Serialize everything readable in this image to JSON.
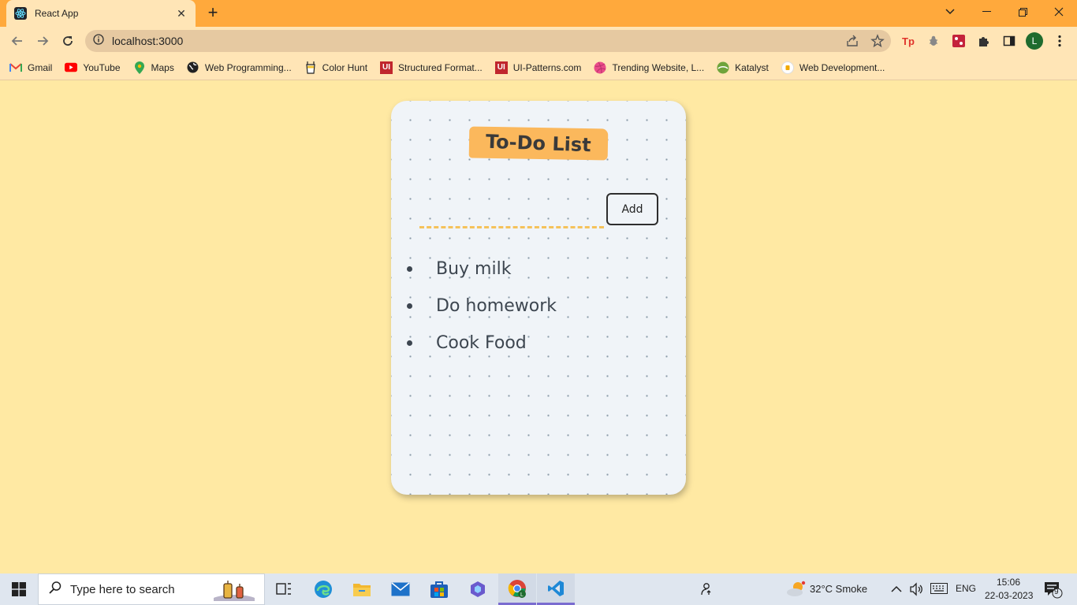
{
  "browser": {
    "tab_title": "React App",
    "url": "localhost:3000",
    "profile_initial": "L",
    "bookmarks": [
      {
        "label": "Gmail",
        "icon": "gmail-icon"
      },
      {
        "label": "YouTube",
        "icon": "youtube-icon"
      },
      {
        "label": "Maps",
        "icon": "maps-icon"
      },
      {
        "label": "Web Programming...",
        "icon": "globe-icon"
      },
      {
        "label": "Color Hunt",
        "icon": "color-hunt-icon"
      },
      {
        "label": "Structured Format...",
        "icon": "ui-icon"
      },
      {
        "label": "UI-Patterns.com",
        "icon": "ui-icon"
      },
      {
        "label": "Trending Website, L...",
        "icon": "dribbble-icon"
      },
      {
        "label": "Katalyst",
        "icon": "katalyst-icon"
      },
      {
        "label": "Web Development...",
        "icon": "web-dev-icon"
      }
    ]
  },
  "app": {
    "title": "To-Do List",
    "add_label": "Add",
    "input_value": "",
    "items": [
      "Buy milk",
      "Do homework",
      "Cook Food"
    ]
  },
  "taskbar": {
    "search_placeholder": "Type here to search",
    "weather": "32°C  Smoke",
    "language": "ENG",
    "time": "15:06",
    "date": "22-03-2023",
    "notification_count": "9"
  },
  "colors": {
    "page_bg": "#ffe9a3",
    "tabstrip": "#ffa93c",
    "title_highlight": "#fbb85c",
    "card_bg": "#f0f4f8"
  }
}
